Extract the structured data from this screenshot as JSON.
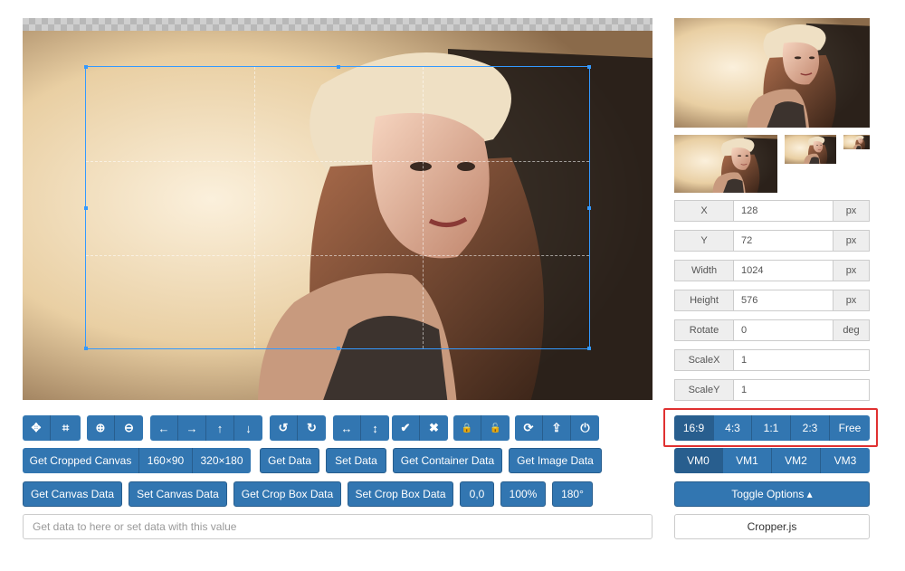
{
  "toolbar_icons": [
    {
      "icon": "move-icon",
      "glyph": "✥"
    },
    {
      "icon": "crop-icon",
      "glyph": "⌗"
    },
    {
      "icon": "zoom-in-icon",
      "glyph": "⊕"
    },
    {
      "icon": "zoom-out-icon",
      "glyph": "⊖"
    },
    {
      "icon": "arrow-left-icon",
      "glyph": "←"
    },
    {
      "icon": "arrow-right-icon",
      "glyph": "→"
    },
    {
      "icon": "arrow-up-icon",
      "glyph": "↑"
    },
    {
      "icon": "arrow-down-icon",
      "glyph": "↓"
    },
    {
      "icon": "rotate-left-icon",
      "glyph": "↺"
    },
    {
      "icon": "rotate-right-icon",
      "glyph": "↻"
    },
    {
      "icon": "flip-horizontal-icon",
      "glyph": "↔"
    },
    {
      "icon": "flip-vertical-icon",
      "glyph": "↕"
    },
    {
      "icon": "check-icon",
      "glyph": "✔"
    },
    {
      "icon": "remove-icon",
      "glyph": "✖"
    },
    {
      "icon": "lock-icon",
      "glyph": "🔒"
    },
    {
      "icon": "unlock-icon",
      "glyph": "🔓"
    },
    {
      "icon": "refresh-icon",
      "glyph": "⟳"
    },
    {
      "icon": "upload-icon",
      "glyph": "⇪"
    },
    {
      "icon": "power-icon",
      "glyph": "⏻"
    }
  ],
  "row2": {
    "get_cropped_canvas": "Get Cropped Canvas",
    "size_160": "160×90",
    "size_320": "320×180",
    "get_data": "Get Data",
    "set_data": "Set Data",
    "get_container_data": "Get Container Data",
    "get_image_data": "Get Image Data"
  },
  "row3": {
    "get_canvas_data": "Get Canvas Data",
    "set_canvas_data": "Set Canvas Data",
    "get_crop_box_data": "Get Crop Box Data",
    "set_crop_box_data": "Set Crop Box Data",
    "zero": "0,0",
    "percent": "100%",
    "deg180": "180°"
  },
  "data_input_placeholder": "Get data to here or set data with this value",
  "fields": [
    {
      "label": "X",
      "value": "128",
      "unit": "px"
    },
    {
      "label": "Y",
      "value": "72",
      "unit": "px"
    },
    {
      "label": "Width",
      "value": "1024",
      "unit": "px"
    },
    {
      "label": "Height",
      "value": "576",
      "unit": "px"
    },
    {
      "label": "Rotate",
      "value": "0",
      "unit": "deg"
    },
    {
      "label": "ScaleX",
      "value": "1",
      "unit": ""
    },
    {
      "label": "ScaleY",
      "value": "1",
      "unit": ""
    }
  ],
  "aspect_ratios": {
    "r169": "16:9",
    "r43": "4:3",
    "r11": "1:1",
    "r23": "2:3",
    "free": "Free",
    "active": "16:9"
  },
  "view_modes": {
    "vm0": "VM0",
    "vm1": "VM1",
    "vm2": "VM2",
    "vm3": "VM3",
    "active": "VM0"
  },
  "toggle_options": "Toggle Options ▴",
  "cropperjs": "Cropper.js",
  "accent_color": "#3276b1",
  "highlight_color": "#e03131"
}
